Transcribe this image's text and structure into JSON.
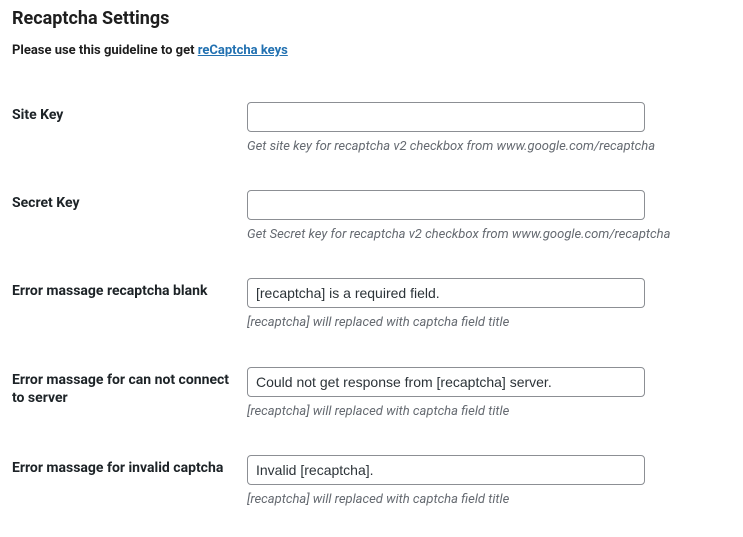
{
  "page": {
    "title": "Recaptcha Settings",
    "guideline_prefix": "Please use this guideline to get ",
    "guideline_link_text": "reCaptcha keys"
  },
  "fields": {
    "site_key": {
      "label": "Site Key",
      "value": "",
      "description": "Get site key for recaptcha v2 checkbox from www.google.com/recaptcha"
    },
    "secret_key": {
      "label": "Secret Key",
      "value": "",
      "description": "Get Secret key for recaptcha v2 checkbox from www.google.com/recaptcha"
    },
    "error_blank": {
      "label": "Error massage recaptcha blank",
      "value": "[recaptcha] is a required field.",
      "description": "[recaptcha] will replaced with captcha field title"
    },
    "error_connect": {
      "label": "Error massage for can not connect to server",
      "value": "Could not get response from [recaptcha] server.",
      "description": "[recaptcha] will replaced with captcha field title"
    },
    "error_invalid": {
      "label": "Error massage for invalid captcha",
      "value": "Invalid [recaptcha].",
      "description": "[recaptcha] will replaced with captcha field title"
    }
  }
}
